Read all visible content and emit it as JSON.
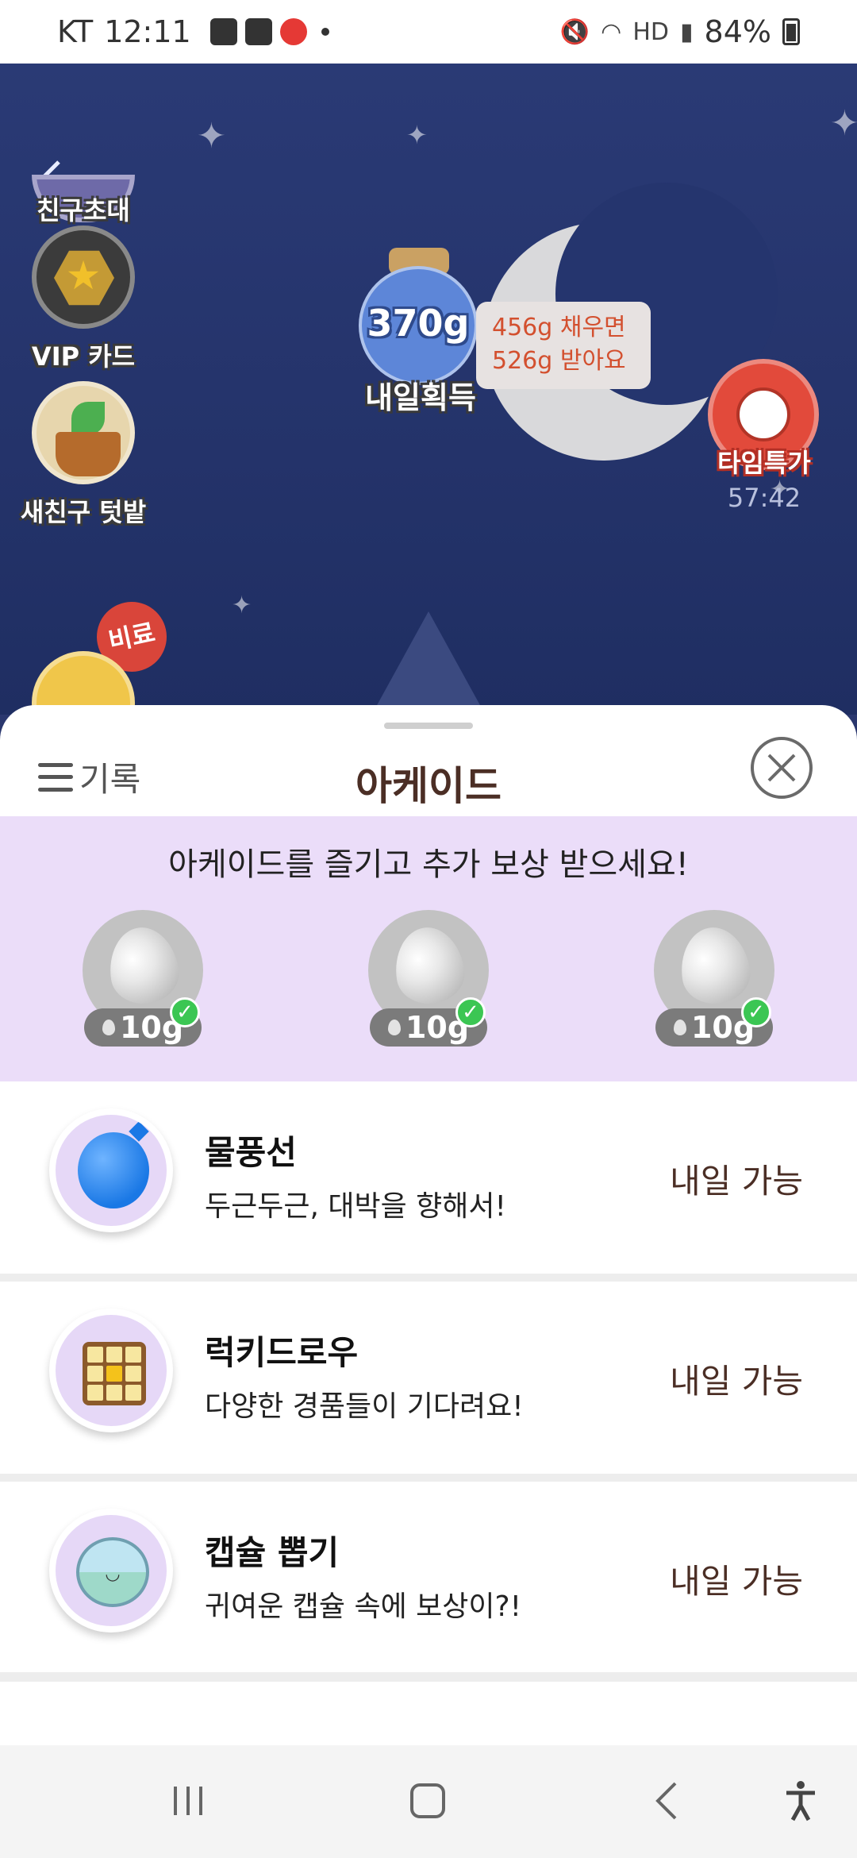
{
  "status_bar": {
    "carrier": "KT",
    "time": "12:11",
    "battery": "84%"
  },
  "scene": {
    "side_menu": [
      {
        "label": "친구초대",
        "icon": "gift-icon"
      },
      {
        "label": "VIP 카드",
        "icon": "star-hexagon-icon"
      },
      {
        "label": "새친구 텃밭",
        "icon": "plant-pot-icon"
      }
    ],
    "fertilizer_badge": "비료",
    "jar": {
      "amount": "370g",
      "label": "내일획득"
    },
    "bubble": {
      "line1": "456g 채우면",
      "line2": "526g 받아요"
    },
    "time_deal": {
      "label": "타임특가",
      "timer": "57:42"
    }
  },
  "sheet": {
    "history_label": "기록",
    "title": "아케이드",
    "promo": {
      "text": "아케이드를 즐기고 추가 보상 받으세요!",
      "rewards": [
        {
          "amount": "10g",
          "claimed": true
        },
        {
          "amount": "10g",
          "claimed": true
        },
        {
          "amount": "10g",
          "claimed": true
        }
      ]
    },
    "games": [
      {
        "name": "물풍선",
        "desc": "두근두근, 대박을 향해서!",
        "status": "내일 가능",
        "icon": "water-balloon-icon"
      },
      {
        "name": "럭키드로우",
        "desc": "다양한 경품들이 기다려요!",
        "status": "내일 가능",
        "icon": "lucky-grid-icon"
      },
      {
        "name": "캡슐 뽑기",
        "desc": "귀여운 캡슐 속에 보상이?!",
        "status": "내일 가능",
        "icon": "capsule-icon"
      }
    ]
  },
  "colors": {
    "promo_bg": "#ebddf9",
    "title_brown": "#4b2e25",
    "night_sky": "#2a376e",
    "check_green": "#3bc653"
  }
}
